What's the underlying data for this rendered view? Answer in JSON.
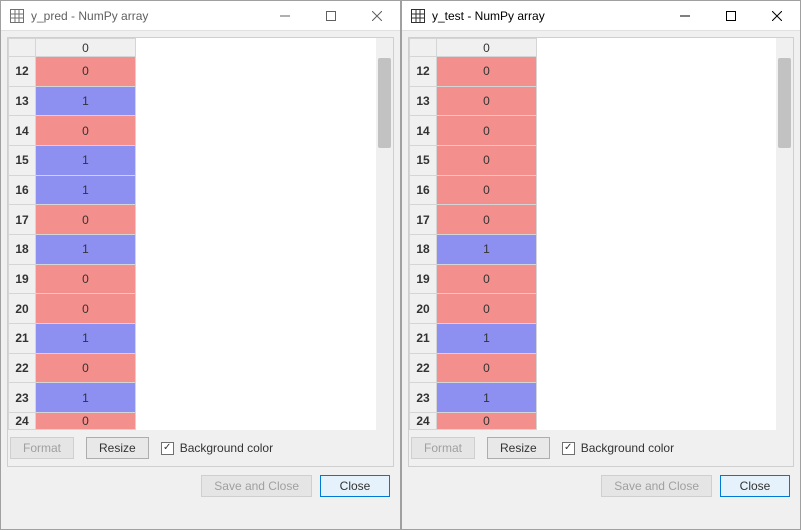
{
  "colors": {
    "cell0": "#f38f8c",
    "cell1": "#8e90f1"
  },
  "buttons": {
    "format": "Format",
    "resize": "Resize",
    "save_and_close": "Save and Close",
    "close": "Close"
  },
  "checkbox": {
    "bgcolor_label": "Background color",
    "bgcolor_checked": true
  },
  "windows": [
    {
      "id": "y_pred",
      "title": "y_pred - NumPy array",
      "column_header": "0",
      "row_start": 12,
      "rows": [
        {
          "index": 12,
          "value": 0
        },
        {
          "index": 13,
          "value": 1
        },
        {
          "index": 14,
          "value": 0
        },
        {
          "index": 15,
          "value": 1
        },
        {
          "index": 16,
          "value": 1
        },
        {
          "index": 17,
          "value": 0
        },
        {
          "index": 18,
          "value": 1
        },
        {
          "index": 19,
          "value": 0
        },
        {
          "index": 20,
          "value": 0
        },
        {
          "index": 21,
          "value": 1
        },
        {
          "index": 22,
          "value": 0
        },
        {
          "index": 23,
          "value": 1
        },
        {
          "index": 24,
          "value": 0
        }
      ]
    },
    {
      "id": "y_test",
      "title": "y_test - NumPy array",
      "column_header": "0",
      "row_start": 12,
      "rows": [
        {
          "index": 12,
          "value": 0
        },
        {
          "index": 13,
          "value": 0
        },
        {
          "index": 14,
          "value": 0
        },
        {
          "index": 15,
          "value": 0
        },
        {
          "index": 16,
          "value": 0
        },
        {
          "index": 17,
          "value": 0
        },
        {
          "index": 18,
          "value": 1
        },
        {
          "index": 19,
          "value": 0
        },
        {
          "index": 20,
          "value": 0
        },
        {
          "index": 21,
          "value": 1
        },
        {
          "index": 22,
          "value": 0
        },
        {
          "index": 23,
          "value": 1
        },
        {
          "index": 24,
          "value": 0
        }
      ]
    }
  ]
}
